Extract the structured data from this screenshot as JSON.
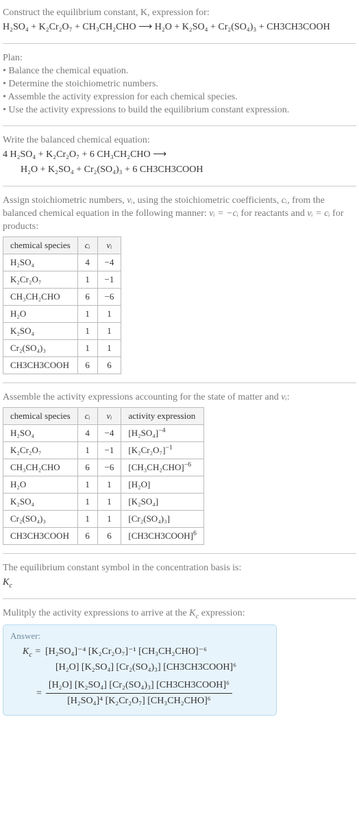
{
  "title_line1": "Construct the equilibrium constant, K, expression for:",
  "unbalanced_eq": "H₂SO₄ + K₂Cr₂O₇ + CH₃CH₂CHO  ⟶  H₂O + K₂SO₄ + Cr₂(SO₄)₃ + CH3CH3COOH",
  "plan_heading": "Plan:",
  "plan_items": [
    "• Balance the chemical equation.",
    "• Determine the stoichiometric numbers.",
    "• Assemble the activity expression for each chemical species.",
    "• Use the activity expressions to build the equilibrium constant expression."
  ],
  "write_balanced_heading": "Write the balanced chemical equation:",
  "balanced_line1": "4 H₂SO₄ + K₂Cr₂O₇ + 6 CH₃CH₂CHO  ⟶",
  "balanced_line2": "H₂O + K₂SO₄ + Cr₂(SO₄)₃ + 6 CH3CH3COOH",
  "assign_text_a": "Assign stoichiometric numbers, ",
  "assign_text_b": ", using the stoichiometric coefficients, ",
  "assign_text_c": ", from the balanced chemical equation in the following manner: ",
  "assign_text_d": " for reactants and ",
  "assign_text_e": " for products:",
  "nu_i": "νᵢ",
  "c_i": "cᵢ",
  "rel1": "νᵢ = −cᵢ",
  "rel2": "νᵢ = cᵢ",
  "table1_headers": [
    "chemical species",
    "cᵢ",
    "νᵢ"
  ],
  "table1_rows": [
    {
      "sp": "H₂SO₄",
      "c": "4",
      "v": "−4"
    },
    {
      "sp": "K₂Cr₂O₇",
      "c": "1",
      "v": "−1"
    },
    {
      "sp": "CH₃CH₂CHO",
      "c": "6",
      "v": "−6"
    },
    {
      "sp": "H₂O",
      "c": "1",
      "v": "1"
    },
    {
      "sp": "K₂SO₄",
      "c": "1",
      "v": "1"
    },
    {
      "sp": "Cr₂(SO₄)₃",
      "c": "1",
      "v": "1"
    },
    {
      "sp": "CH3CH3COOH",
      "c": "6",
      "v": "6"
    }
  ],
  "assemble_text_a": "Assemble the activity expressions accounting for the state of matter and ",
  "assemble_text_b": ":",
  "table2_headers": [
    "chemical species",
    "cᵢ",
    "νᵢ",
    "activity expression"
  ],
  "table2_rows": [
    {
      "sp": "H₂SO₄",
      "c": "4",
      "v": "−4",
      "ae_base": "[H₂SO₄]",
      "ae_exp": "−4"
    },
    {
      "sp": "K₂Cr₂O₇",
      "c": "1",
      "v": "−1",
      "ae_base": "[K₂Cr₂O₇]",
      "ae_exp": "−1"
    },
    {
      "sp": "CH₃CH₂CHO",
      "c": "6",
      "v": "−6",
      "ae_base": "[CH₃CH₂CHO]",
      "ae_exp": "−6"
    },
    {
      "sp": "H₂O",
      "c": "1",
      "v": "1",
      "ae_base": "[H₂O]",
      "ae_exp": ""
    },
    {
      "sp": "K₂SO₄",
      "c": "1",
      "v": "1",
      "ae_base": "[K₂SO₄]",
      "ae_exp": ""
    },
    {
      "sp": "Cr₂(SO₄)₃",
      "c": "1",
      "v": "1",
      "ae_base": "[Cr₂(SO₄)₃]",
      "ae_exp": ""
    },
    {
      "sp": "CH3CH3COOH",
      "c": "6",
      "v": "6",
      "ae_base": "[CH3CH3COOH]",
      "ae_exp": "6"
    }
  ],
  "kc_symbol_text": "The equilibrium constant symbol in the concentration basis is:",
  "kc_symbol": "K_c",
  "multiply_text_a": "Mulitply the activity expressions to arrive at the ",
  "multiply_text_b": " expression:",
  "answer_label": "Answer:",
  "kc_eq": "K_c =",
  "expr_line1": "[H₂SO₄]⁻⁴ [K₂Cr₂O₇]⁻¹ [CH₃CH₂CHO]⁻⁶",
  "expr_line2": "[H₂O] [K₂SO₄] [Cr₂(SO₄)₃] [CH3CH3COOH]⁶",
  "frac_num": "[H₂O] [K₂SO₄] [Cr₂(SO₄)₃] [CH3CH3COOH]⁶",
  "frac_den": "[H₂SO₄]⁴ [K₂Cr₂O₇] [CH₃CH₂CHO]⁶",
  "eq_sign": "="
}
